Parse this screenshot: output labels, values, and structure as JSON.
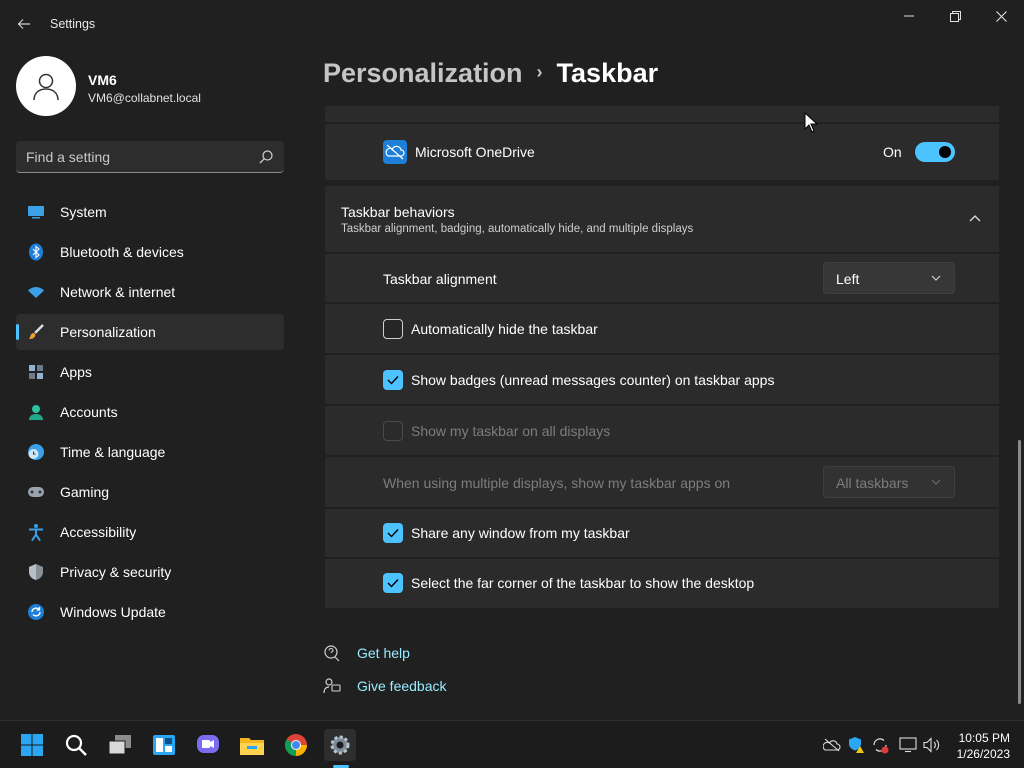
{
  "window": {
    "title": "Settings",
    "controls": {
      "minimize": "–",
      "maximize": "❐",
      "close": "✕"
    }
  },
  "profile": {
    "name": "VM6",
    "email": "VM6@collabnet.local"
  },
  "search": {
    "placeholder": "Find a setting"
  },
  "sidebar": {
    "items": [
      {
        "label": "System",
        "icon": "system-icon"
      },
      {
        "label": "Bluetooth & devices",
        "icon": "bluetooth-icon"
      },
      {
        "label": "Network & internet",
        "icon": "wifi-icon"
      },
      {
        "label": "Personalization",
        "icon": "brush-icon",
        "active": true
      },
      {
        "label": "Apps",
        "icon": "apps-icon"
      },
      {
        "label": "Accounts",
        "icon": "accounts-icon"
      },
      {
        "label": "Time & language",
        "icon": "clock-globe-icon"
      },
      {
        "label": "Gaming",
        "icon": "gamepad-icon"
      },
      {
        "label": "Accessibility",
        "icon": "accessibility-icon"
      },
      {
        "label": "Privacy & security",
        "icon": "shield-icon"
      },
      {
        "label": "Windows Update",
        "icon": "update-icon"
      }
    ]
  },
  "breadcrumb": {
    "parent": "Personalization",
    "separator": "›",
    "current": "Taskbar"
  },
  "onedrive": {
    "label": "Microsoft OneDrive",
    "state": "On",
    "on": true
  },
  "behaviors": {
    "title": "Taskbar behaviors",
    "subtitle": "Taskbar alignment, badging, automatically hide, and multiple displays",
    "alignment": {
      "label": "Taskbar alignment",
      "value": "Left"
    },
    "auto_hide": {
      "label": "Automatically hide the taskbar",
      "checked": false
    },
    "badges": {
      "label": "Show badges (unread messages counter) on taskbar apps",
      "checked": true
    },
    "all_displays": {
      "label": "Show my taskbar on all displays",
      "checked": false,
      "disabled": true
    },
    "multi_display": {
      "label": "When using multiple displays, show my taskbar apps on",
      "value": "All taskbars",
      "disabled": true
    },
    "share_window": {
      "label": "Share any window from my taskbar",
      "checked": true
    },
    "far_corner": {
      "label": "Select the far corner of the taskbar to show the desktop",
      "checked": true
    }
  },
  "links": {
    "help": "Get help",
    "feedback": "Give feedback"
  },
  "taskbar": {
    "apps": [
      "start-icon",
      "search-icon",
      "task-view-icon",
      "widgets-icon",
      "chat-icon",
      "file-explorer-icon",
      "chrome-icon",
      "settings-icon"
    ],
    "tray": [
      "onedrive-offline-icon",
      "defender-warning-icon",
      "sync-error-icon",
      "network-icon",
      "volume-icon"
    ],
    "time": "10:05 PM",
    "date": "1/26/2023"
  },
  "colors": {
    "accent": "#4cc2ff",
    "background": "#202020",
    "card": "#2b2b2b",
    "link": "#99ebff"
  }
}
